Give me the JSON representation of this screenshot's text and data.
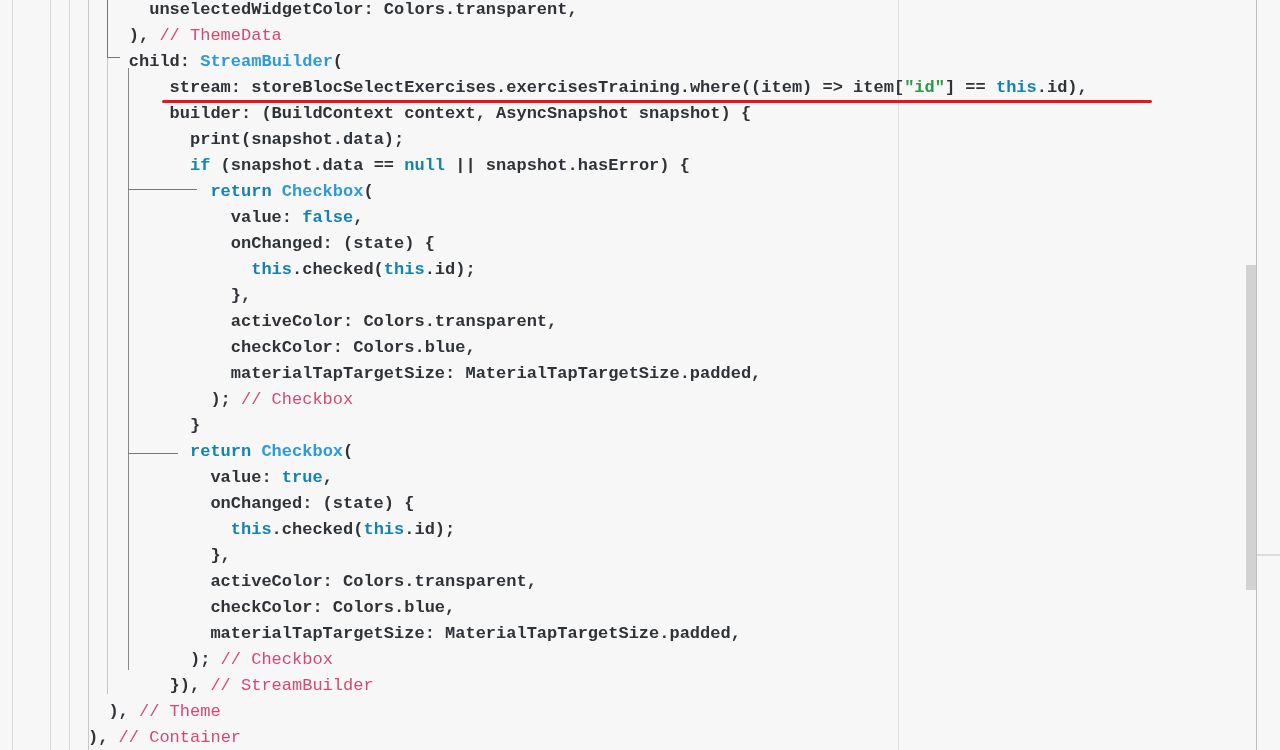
{
  "editor": {
    "lines": [
      {
        "tokens": [
          {
            "kind": "plain",
            "text": "      unselectedWidgetColor: Colors.transparent,"
          }
        ]
      },
      {
        "tokens": [
          {
            "kind": "plain",
            "text": "    ), "
          },
          {
            "kind": "comment",
            "text": "// ThemeData"
          }
        ]
      },
      {
        "tokens": [
          {
            "kind": "plain",
            "text": "    child: "
          },
          {
            "kind": "type",
            "text": "StreamBuilder"
          },
          {
            "kind": "plain",
            "text": "("
          }
        ]
      },
      {
        "tokens": [
          {
            "kind": "plain",
            "text": "        stream: storeBlocSelectExercises.exercisesTraining.where((item) => item["
          },
          {
            "kind": "string",
            "text": "\"id\""
          },
          {
            "kind": "plain",
            "text": "] == "
          },
          {
            "kind": "keyword",
            "text": "this"
          },
          {
            "kind": "plain",
            "text": ".id),"
          }
        ],
        "underlined": true
      },
      {
        "tokens": [
          {
            "kind": "plain",
            "text": "        builder: (BuildContext context, AsyncSnapshot snapshot) {"
          }
        ]
      },
      {
        "tokens": [
          {
            "kind": "plain",
            "text": "          print(snapshot.data);"
          }
        ]
      },
      {
        "tokens": [
          {
            "kind": "keyword",
            "text": "          if"
          },
          {
            "kind": "plain",
            "text": " (snapshot.data == "
          },
          {
            "kind": "keyword",
            "text": "null"
          },
          {
            "kind": "plain",
            "text": " || snapshot.hasError) {"
          }
        ]
      },
      {
        "tokens": [
          {
            "kind": "keyword",
            "text": "            return"
          },
          {
            "kind": "type",
            "text": " Checkbox"
          },
          {
            "kind": "plain",
            "text": "("
          }
        ]
      },
      {
        "tokens": [
          {
            "kind": "plain",
            "text": "              value: "
          },
          {
            "kind": "keyword",
            "text": "false"
          },
          {
            "kind": "plain",
            "text": ","
          }
        ]
      },
      {
        "tokens": [
          {
            "kind": "plain",
            "text": "              onChanged: (state) {"
          }
        ]
      },
      {
        "tokens": [
          {
            "kind": "keyword",
            "text": "                this"
          },
          {
            "kind": "plain",
            "text": ".checked("
          },
          {
            "kind": "keyword",
            "text": "this"
          },
          {
            "kind": "plain",
            "text": ".id);"
          }
        ]
      },
      {
        "tokens": [
          {
            "kind": "plain",
            "text": "              },"
          }
        ]
      },
      {
        "tokens": [
          {
            "kind": "plain",
            "text": "              activeColor: Colors.transparent,"
          }
        ]
      },
      {
        "tokens": [
          {
            "kind": "plain",
            "text": "              checkColor: Colors.blue,"
          }
        ]
      },
      {
        "tokens": [
          {
            "kind": "plain",
            "text": "              materialTapTargetSize: MaterialTapTargetSize.padded,"
          }
        ]
      },
      {
        "tokens": [
          {
            "kind": "plain",
            "text": "            ); "
          },
          {
            "kind": "comment",
            "text": "// Checkbox"
          }
        ]
      },
      {
        "tokens": [
          {
            "kind": "plain",
            "text": "          }"
          }
        ]
      },
      {
        "tokens": [
          {
            "kind": "keyword",
            "text": "          return"
          },
          {
            "kind": "type",
            "text": " Checkbox"
          },
          {
            "kind": "plain",
            "text": "("
          }
        ]
      },
      {
        "tokens": [
          {
            "kind": "plain",
            "text": "            value: "
          },
          {
            "kind": "keyword",
            "text": "true"
          },
          {
            "kind": "plain",
            "text": ","
          }
        ]
      },
      {
        "tokens": [
          {
            "kind": "plain",
            "text": "            onChanged: (state) {"
          }
        ]
      },
      {
        "tokens": [
          {
            "kind": "keyword",
            "text": "              this"
          },
          {
            "kind": "plain",
            "text": ".checked("
          },
          {
            "kind": "keyword",
            "text": "this"
          },
          {
            "kind": "plain",
            "text": ".id);"
          }
        ]
      },
      {
        "tokens": [
          {
            "kind": "plain",
            "text": "            },"
          }
        ]
      },
      {
        "tokens": [
          {
            "kind": "plain",
            "text": "            activeColor: Colors.transparent,"
          }
        ]
      },
      {
        "tokens": [
          {
            "kind": "plain",
            "text": "            checkColor: Colors.blue,"
          }
        ]
      },
      {
        "tokens": [
          {
            "kind": "plain",
            "text": "            materialTapTargetSize: MaterialTapTargetSize.padded,"
          }
        ]
      },
      {
        "tokens": [
          {
            "kind": "plain",
            "text": "          ); "
          },
          {
            "kind": "comment",
            "text": "// Checkbox"
          }
        ]
      },
      {
        "tokens": [
          {
            "kind": "plain",
            "text": "        }), "
          },
          {
            "kind": "comment",
            "text": "// StreamBuilder"
          }
        ]
      },
      {
        "tokens": [
          {
            "kind": "plain",
            "text": "  ), "
          },
          {
            "kind": "comment",
            "text": "// Theme"
          }
        ]
      },
      {
        "tokens": [
          {
            "kind": "plain",
            "text": "), "
          },
          {
            "kind": "comment",
            "text": "// Container"
          }
        ]
      }
    ]
  }
}
